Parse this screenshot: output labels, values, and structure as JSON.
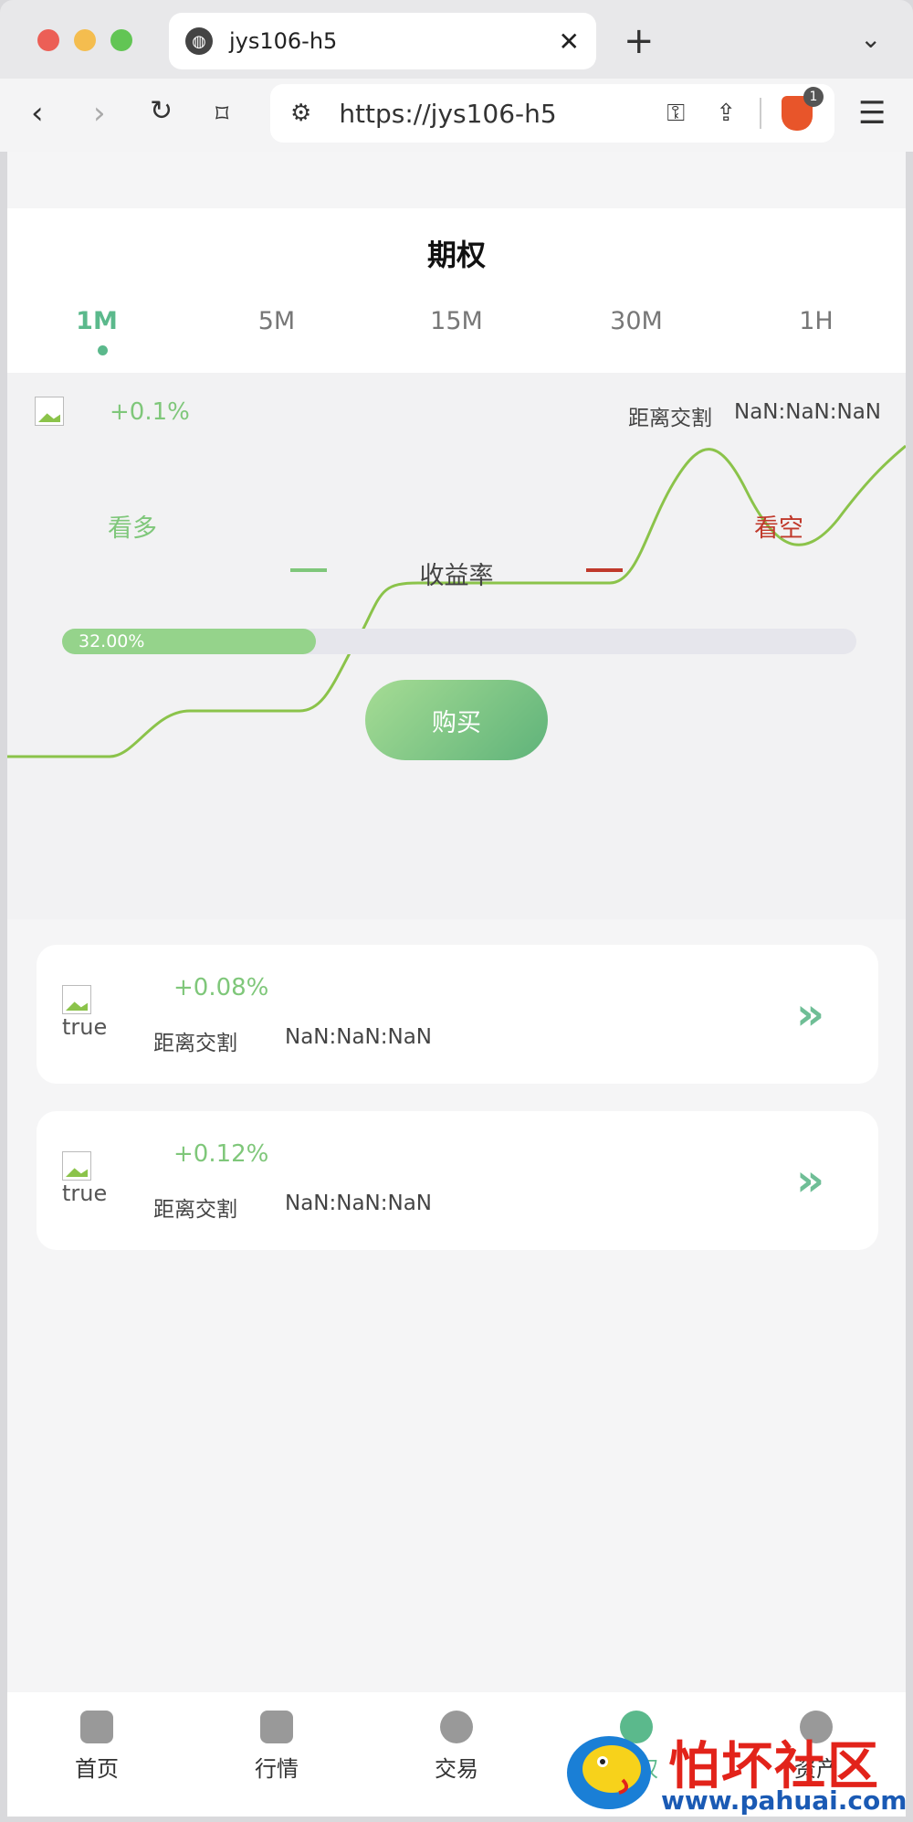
{
  "browser": {
    "tab_title": "jys106-h5",
    "tab_close": "✕",
    "new_tab": "+",
    "url": "https://jys106-h5",
    "shields_count": "1"
  },
  "page": {
    "title": "期权",
    "periods": [
      {
        "label": "1M",
        "active": true
      },
      {
        "label": "5M",
        "active": false
      },
      {
        "label": "15M",
        "active": false
      },
      {
        "label": "30M",
        "active": false
      },
      {
        "label": "1H",
        "active": false
      }
    ]
  },
  "main_panel": {
    "rate": "+0.1%",
    "countdown_label": "距离交割",
    "countdown_value": "NaN:NaN:NaN",
    "long_label": "看多",
    "short_label": "看空",
    "yield_label": "收益率",
    "progress_percent": 32,
    "progress_text": "32.00%",
    "buy_label": "购买",
    "colors": {
      "long": "#7fc77a",
      "short": "#c0392b",
      "accent": "#5bb98c"
    }
  },
  "cards": [
    {
      "alt": "true",
      "rate": "+0.08%",
      "countdown_label": "距离交割",
      "countdown_value": "NaN:NaN:NaN"
    },
    {
      "alt": "true",
      "rate": "+0.12%",
      "countdown_label": "距离交割",
      "countdown_value": "NaN:NaN:NaN"
    }
  ],
  "bottom_nav": [
    {
      "label": "首页",
      "icon": "home-icon"
    },
    {
      "label": "行情",
      "icon": "chart-bars-icon"
    },
    {
      "label": "交易",
      "icon": "exchange-icon"
    },
    {
      "label": "期权",
      "icon": "trend-icon"
    },
    {
      "label": "资产",
      "icon": "pie-icon"
    }
  ],
  "watermark": {
    "title": "怕坏社区",
    "url": "www.pahuai.com"
  }
}
